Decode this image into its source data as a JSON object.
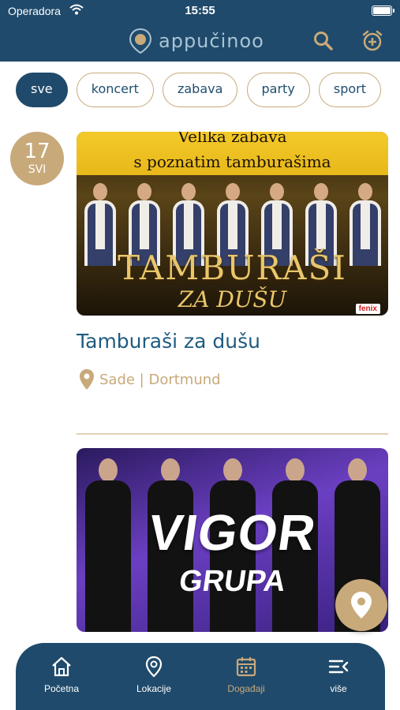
{
  "status_bar": {
    "carrier": "Operadora",
    "time": "15:55"
  },
  "header": {
    "app_name": "appučinoo",
    "logo_icon": "location-pin-logo-icon",
    "search_icon": "search-icon",
    "alarm_icon": "alarm-add-icon"
  },
  "filters": {
    "chips": [
      {
        "label": "sve",
        "active": true
      },
      {
        "label": "koncert",
        "active": false
      },
      {
        "label": "zabava",
        "active": false
      },
      {
        "label": "party",
        "active": false
      },
      {
        "label": "sport",
        "active": false
      }
    ]
  },
  "events": [
    {
      "date_day": "17",
      "date_month": "SVI",
      "poster_text_top": "Velika zabava",
      "poster_text_sub": "s poznatim tamburašima",
      "poster_title": "TAMBURAŠI",
      "poster_title_2": "ZA DUŠU",
      "poster_logo": "fenix",
      "title": "Tamburaši za dušu",
      "location": "Sade | Dortmund"
    },
    {
      "poster_title": "VIGOR",
      "poster_sub": "GRUPA"
    }
  ],
  "colors": {
    "primary": "#1f4a6b",
    "accent": "#c8a97a",
    "title_text": "#1f5b80"
  },
  "nav": {
    "items": [
      {
        "label": "Početna",
        "icon": "home-icon",
        "active": false
      },
      {
        "label": "Lokacije",
        "icon": "location-pin-icon",
        "active": false
      },
      {
        "label": "Događaji",
        "icon": "calendar-icon",
        "active": true
      },
      {
        "label": "više",
        "icon": "menu-more-icon",
        "active": false
      }
    ]
  }
}
